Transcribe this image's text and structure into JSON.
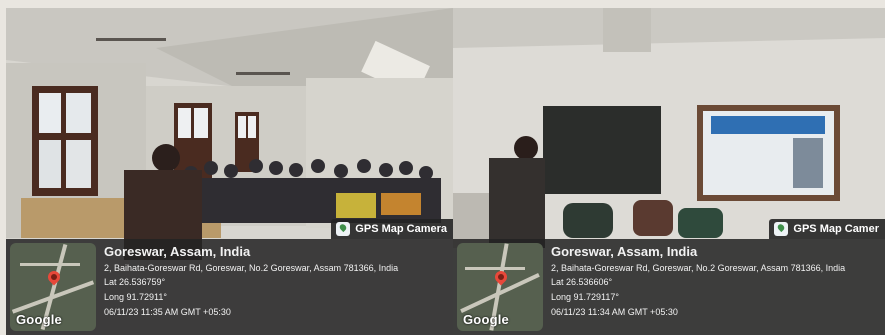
{
  "photos": [
    {
      "badge": "GPS Map Camera",
      "location": "Goreswar, Assam, India",
      "address": "2, Baihata-Goreswar Rd, Goreswar, No.2 Goreswar, Assam 781366, India",
      "lat": "Lat 26.536759°",
      "long": "Long 91.72911°",
      "datetime": "06/11/23 11:35 AM GMT +05:30",
      "map_logo": "Google"
    },
    {
      "badge": "GPS Map Camer",
      "location": "Goreswar, Assam, India",
      "address": "2, Baihata-Goreswar Rd, Goreswar, No.2 Goreswar, Assam 781366, India",
      "lat": "Lat 26.536606°",
      "long": "Long 91.729117°",
      "datetime": "06/11/23 11:34 AM GMT +05:30",
      "map_logo": "Google"
    }
  ],
  "colors": {
    "overlay": "#232323",
    "pin": "#e8483a",
    "text": "#f2f2f2"
  },
  "icons": [
    "map-pin-icon",
    "gps-camera-icon"
  ]
}
